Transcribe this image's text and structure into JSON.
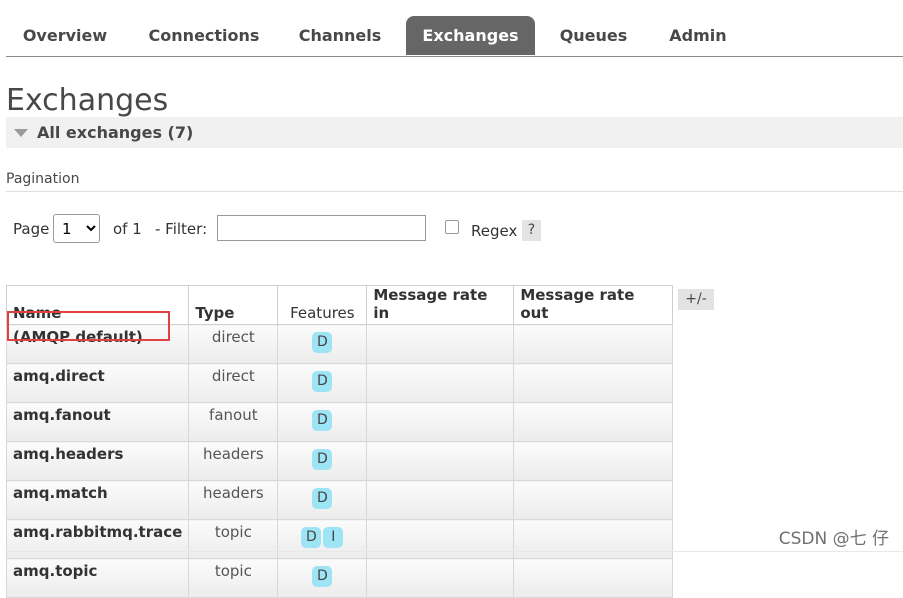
{
  "nav": {
    "tabs": [
      {
        "label": "Overview",
        "active": false
      },
      {
        "label": "Connections",
        "active": false
      },
      {
        "label": "Channels",
        "active": false
      },
      {
        "label": "Exchanges",
        "active": true
      },
      {
        "label": "Queues",
        "active": false
      },
      {
        "label": "Admin",
        "active": false
      }
    ]
  },
  "page": {
    "title": "Exchanges",
    "section_label": "All exchanges (7)"
  },
  "pagination": {
    "heading": "Pagination",
    "page_label": "Page",
    "page_value": "1",
    "of_label": "of 1",
    "filter_label": "- Filter:",
    "filter_value": "",
    "regex_label": "Regex",
    "regex_checked": false,
    "help_label": "?"
  },
  "table": {
    "columns": [
      "Name",
      "Type",
      "Features",
      "Message rate in",
      "Message rate out"
    ],
    "toggle_columns_label": "+/-",
    "rows": [
      {
        "name": "(AMQP default)",
        "type": "direct",
        "features": [
          "D"
        ],
        "rate_in": "",
        "rate_out": ""
      },
      {
        "name": "amq.direct",
        "type": "direct",
        "features": [
          "D"
        ],
        "rate_in": "",
        "rate_out": ""
      },
      {
        "name": "amq.fanout",
        "type": "fanout",
        "features": [
          "D"
        ],
        "rate_in": "",
        "rate_out": ""
      },
      {
        "name": "amq.headers",
        "type": "headers",
        "features": [
          "D"
        ],
        "rate_in": "",
        "rate_out": ""
      },
      {
        "name": "amq.match",
        "type": "headers",
        "features": [
          "D"
        ],
        "rate_in": "",
        "rate_out": ""
      },
      {
        "name": "amq.rabbitmq.trace",
        "type": "topic",
        "features": [
          "D",
          "I"
        ],
        "rate_in": "",
        "rate_out": ""
      },
      {
        "name": "amq.topic",
        "type": "topic",
        "features": [
          "D"
        ],
        "rate_in": "",
        "rate_out": ""
      }
    ]
  },
  "watermark": "CSDN @七 仔",
  "colors": {
    "active_tab_bg": "#666666",
    "badge_bg": "#9de4f4",
    "highlight_border": "#e04141"
  }
}
